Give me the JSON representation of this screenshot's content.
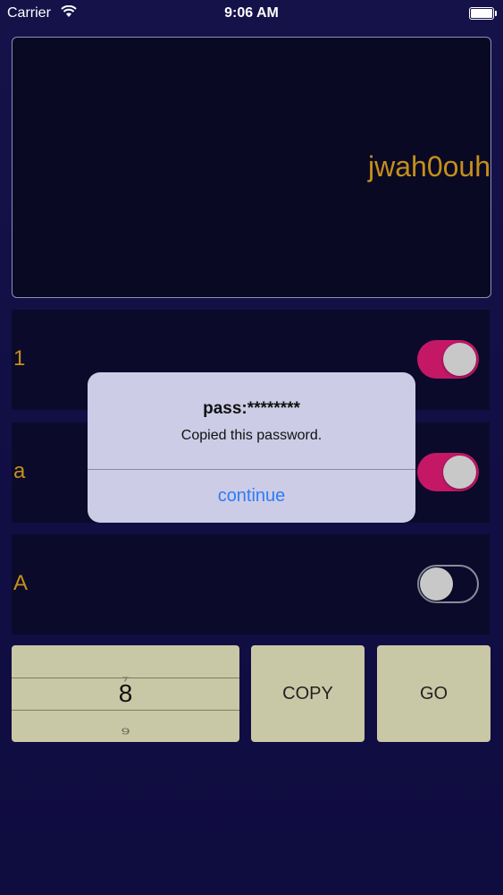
{
  "status_bar": {
    "carrier": "Carrier",
    "time": "9:06 AM"
  },
  "display": {
    "password": "jwah0ouh"
  },
  "options": [
    {
      "label": "1",
      "enabled": true
    },
    {
      "label": "a",
      "enabled": true
    },
    {
      "label": "A",
      "enabled": false
    }
  ],
  "length_picker": {
    "above": "7",
    "value": "8",
    "below": "9"
  },
  "buttons": {
    "copy": "COPY",
    "go": "GO"
  },
  "alert": {
    "title": "pass:********",
    "message": "Copied this password.",
    "button": "continue"
  },
  "colors": {
    "background": "#120f45",
    "accent_text": "#c48f1b",
    "toggle_on": "#c41867",
    "button_bg": "#c9c8a6",
    "alert_button": "#2d7cf6"
  }
}
